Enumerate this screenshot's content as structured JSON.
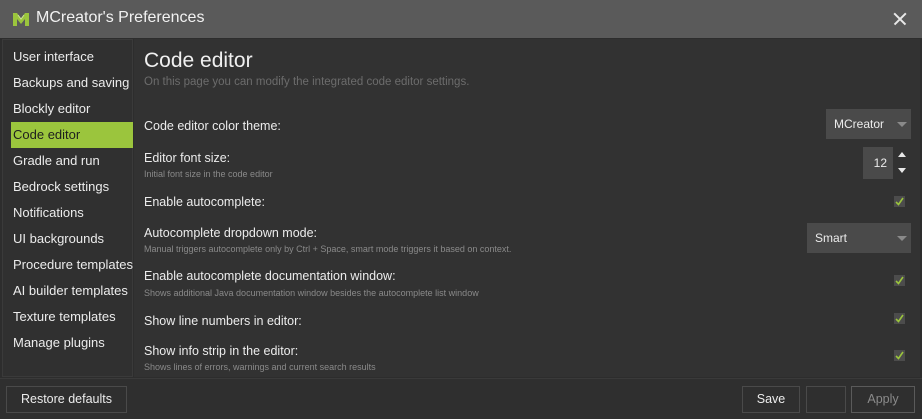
{
  "window": {
    "title": "MCreator's Preferences",
    "icon": "mcreator-logo-icon",
    "close_icon": "close-icon"
  },
  "sidebar": {
    "items": [
      {
        "label": "User interface"
      },
      {
        "label": "Backups and saving"
      },
      {
        "label": "Blockly editor"
      },
      {
        "label": "Code editor",
        "active": true
      },
      {
        "label": "Gradle and run"
      },
      {
        "label": "Bedrock settings"
      },
      {
        "label": "Notifications"
      },
      {
        "label": "UI backgrounds"
      },
      {
        "label": "Procedure templates"
      },
      {
        "label": "AI builder templates"
      },
      {
        "label": "Texture templates"
      },
      {
        "label": "Manage plugins"
      }
    ]
  },
  "page": {
    "title": "Code editor",
    "subtitle": "On this page you can modify the integrated code editor settings."
  },
  "settings": {
    "color_theme": {
      "label": "Code editor color theme:",
      "value": "MCreator"
    },
    "font_size": {
      "label": "Editor font size:",
      "desc": "Initial font size in the code editor",
      "value": "12"
    },
    "autocomplete": {
      "label": "Enable autocomplete:",
      "checked": true
    },
    "dropdown_mode": {
      "label": "Autocomplete dropdown mode:",
      "desc": "Manual triggers autocomplete only by Ctrl + Space, smart mode triggers it based on context.",
      "value": "Smart"
    },
    "doc_window": {
      "label": "Enable autocomplete documentation window:",
      "desc": "Shows additional Java documentation window besides the autocomplete list window",
      "checked": true
    },
    "line_numbers": {
      "label": "Show line numbers in editor:",
      "checked": true
    },
    "info_strip": {
      "label": "Show info strip in the editor:",
      "desc": "Shows lines of errors, warnings and current search results",
      "checked": true
    }
  },
  "buttons": {
    "restore": "Restore defaults",
    "save": "Save",
    "cancel": "",
    "apply": "Apply"
  },
  "colors": {
    "accent": "#9bc53d",
    "checkmark": "#9bc53d",
    "background": "#2d2d2d",
    "titlebar": "#5a5a5a"
  }
}
